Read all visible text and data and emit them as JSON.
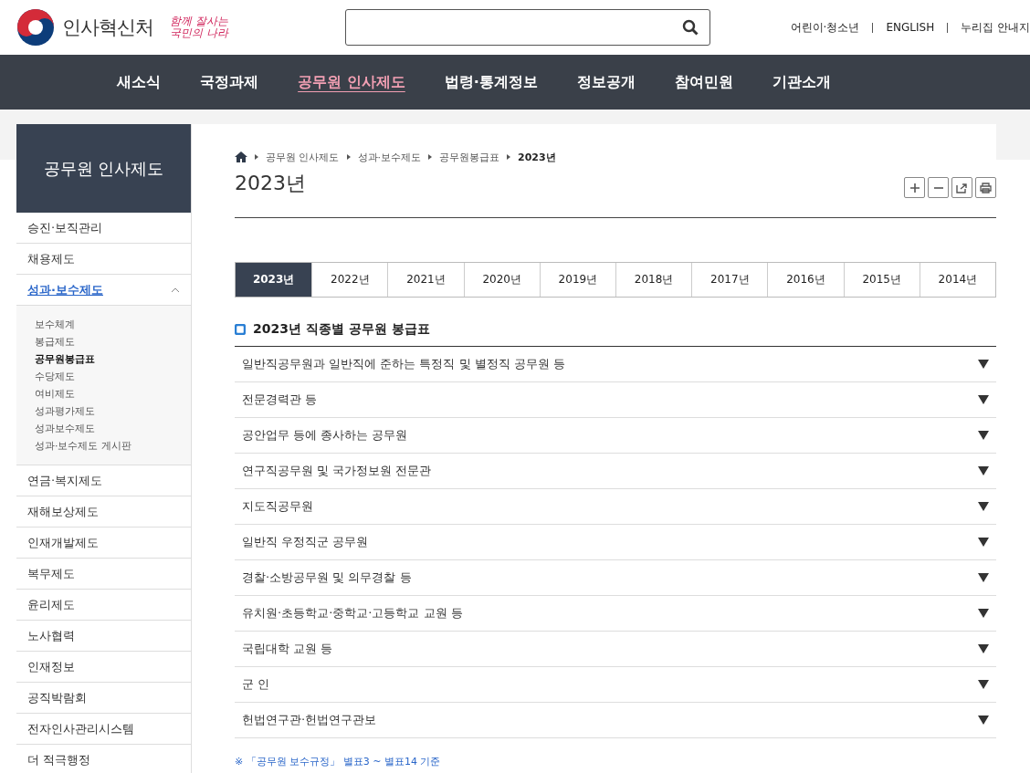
{
  "header": {
    "logo_text": "인사혁신처",
    "slogan": "함께 잘사는 국민의 나라",
    "utility_links": [
      "어린이·청소년",
      "ENGLISH",
      "누리집 안내지"
    ]
  },
  "nav": [
    {
      "label": "새소식",
      "selected": false
    },
    {
      "label": "국정과제",
      "selected": false
    },
    {
      "label": "공무원 인사제도",
      "selected": true
    },
    {
      "label": "법령·통계정보",
      "selected": false
    },
    {
      "label": "정보공개",
      "selected": false
    },
    {
      "label": "참여민원",
      "selected": false
    },
    {
      "label": "기관소개",
      "selected": false
    }
  ],
  "sidebar": {
    "title": "공무원 인사제도",
    "items": [
      {
        "label": "승진·보직관리",
        "selected": false,
        "expanded": false
      },
      {
        "label": "채용제도",
        "selected": false,
        "expanded": false
      },
      {
        "label": "성과·보수제도",
        "selected": true,
        "expanded": true,
        "children": [
          {
            "label": "보수체계",
            "selected": false
          },
          {
            "label": "봉급제도",
            "selected": false
          },
          {
            "label": "공무원봉급표",
            "selected": true
          },
          {
            "label": "수당제도",
            "selected": false
          },
          {
            "label": "여비제도",
            "selected": false
          },
          {
            "label": "성과평가제도",
            "selected": false
          },
          {
            "label": "성과보수제도",
            "selected": false
          },
          {
            "label": "성과·보수제도 게시판",
            "selected": false
          }
        ]
      },
      {
        "label": "연금·복지제도",
        "selected": false,
        "expanded": false
      },
      {
        "label": "재해보상제도",
        "selected": false,
        "expanded": false
      },
      {
        "label": "인재개발제도",
        "selected": false,
        "expanded": false
      },
      {
        "label": "복무제도",
        "selected": false,
        "expanded": false
      },
      {
        "label": "윤리제도",
        "selected": false,
        "expanded": false
      },
      {
        "label": "노사협력",
        "selected": false,
        "expanded": false
      },
      {
        "label": "인재정보",
        "selected": false,
        "expanded": false
      },
      {
        "label": "공직박람회",
        "selected": false,
        "expanded": false
      },
      {
        "label": "전자인사관리시스템",
        "selected": false,
        "expanded": false
      },
      {
        "label": "더 적극행정",
        "selected": false,
        "expanded": false
      }
    ]
  },
  "breadcrumb": [
    "공무원 인사제도",
    "성과·보수제도",
    "공무원봉급표",
    "2023년"
  ],
  "page_title": "2023년",
  "tools": [
    {
      "kind": "plus"
    },
    {
      "kind": "minus"
    },
    {
      "kind": "share"
    },
    {
      "kind": "print"
    }
  ],
  "year_tabs": [
    {
      "label": "2023년",
      "selected": true
    },
    {
      "label": "2022년",
      "selected": false
    },
    {
      "label": "2021년",
      "selected": false
    },
    {
      "label": "2020년",
      "selected": false
    },
    {
      "label": "2019년",
      "selected": false
    },
    {
      "label": "2018년",
      "selected": false
    },
    {
      "label": "2017년",
      "selected": false
    },
    {
      "label": "2016년",
      "selected": false
    },
    {
      "label": "2015년",
      "selected": false
    },
    {
      "label": "2014년",
      "selected": false
    }
  ],
  "section_title": "2023년 직종별 공무원 봉급표",
  "accordion": [
    {
      "label": "일반직공무원과 일반직에 준하는 특정직 및 별정직 공무원 등",
      "expanded": false
    },
    {
      "label": "전문경력관 등",
      "expanded": false
    },
    {
      "label": "공안업무 등에 종사하는 공무원",
      "expanded": false
    },
    {
      "label": "연구직공무원 및 국가정보원 전문관",
      "expanded": false
    },
    {
      "label": "지도직공무원",
      "expanded": false
    },
    {
      "label": "일반직 우정직군 공무원",
      "expanded": false
    },
    {
      "label": "경찰·소방공무원 및 의무경찰 등",
      "expanded": false
    },
    {
      "label": "유치원·초등학교·중학교·고등학교 교원 등",
      "expanded": false
    },
    {
      "label": "국립대학 교원 등",
      "expanded": false
    },
    {
      "label": "군 인",
      "expanded": false
    },
    {
      "label": "헌법연구관·헌법연구관보",
      "expanded": false
    }
  ],
  "footnote": "※ 「공무원 보수규정」 별표3 ~ 별표14 기준"
}
